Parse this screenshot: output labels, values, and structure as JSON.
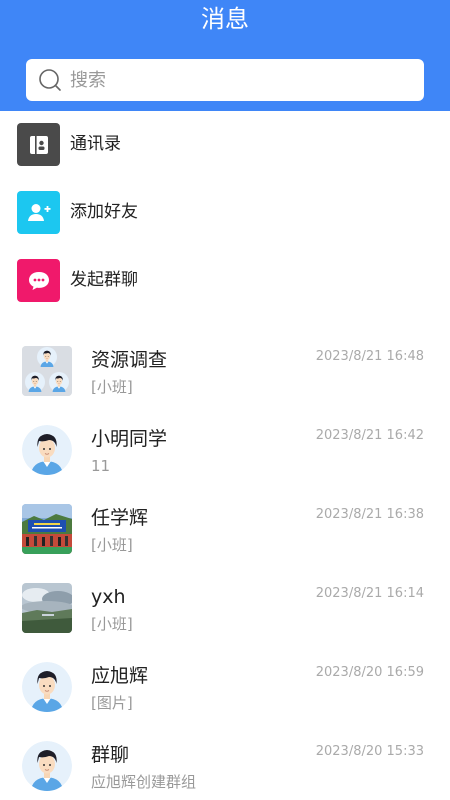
{
  "header": {
    "title": "消息"
  },
  "search": {
    "placeholder": "搜索",
    "value": ""
  },
  "menu": [
    {
      "label": "通讯录",
      "icon": "contacts-book-icon",
      "color": "#4a4a4a"
    },
    {
      "label": "添加好友",
      "icon": "add-friend-icon",
      "color": "#1cc7f0"
    },
    {
      "label": "发起群聊",
      "icon": "group-chat-icon",
      "color": "#f0196b"
    }
  ],
  "chats": [
    {
      "name": "资源调查",
      "preview": "[小班]",
      "time": "2023/8/21 16:48",
      "avatar": "group-avatar"
    },
    {
      "name": "小明同学",
      "preview": "11",
      "time": "2023/8/21 16:42",
      "avatar": "person-avatar"
    },
    {
      "name": "任学辉",
      "preview": "[小班]",
      "time": "2023/8/21 16:38",
      "avatar": "photo-avatar"
    },
    {
      "name": "yxh",
      "preview": "[小班]",
      "time": "2023/8/21 16:14",
      "avatar": "landscape-avatar"
    },
    {
      "name": "应旭辉",
      "preview": "[图片]",
      "time": "2023/8/20 16:59",
      "avatar": "person-avatar"
    },
    {
      "name": "群聊",
      "preview": "应旭辉创建群组",
      "time": "2023/8/20 15:33",
      "avatar": "person-avatar"
    }
  ],
  "colors": {
    "brand": "#3f86f7",
    "text": "#222222",
    "muted": "#999999"
  }
}
